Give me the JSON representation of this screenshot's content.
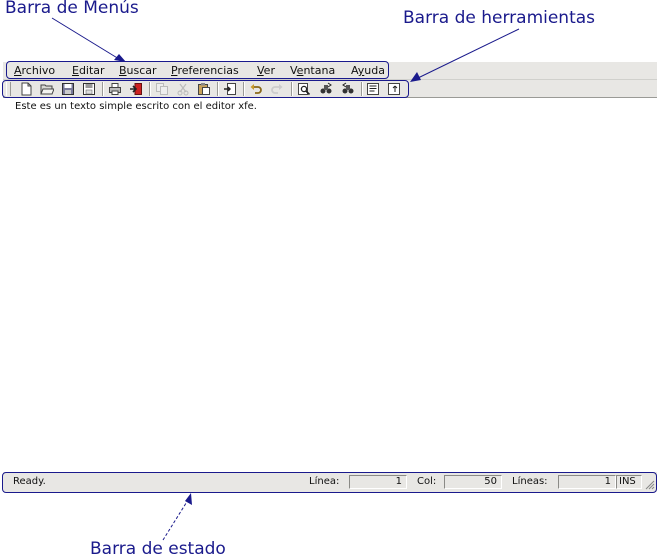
{
  "callouts": {
    "menubar": "Barra de Menús",
    "toolbar": "Barra de herramientas",
    "statusbar": "Barra de estado"
  },
  "menubar": {
    "items": [
      {
        "label": "Archivo",
        "accel": "A"
      },
      {
        "label": "Editar",
        "accel": "E"
      },
      {
        "label": "Buscar",
        "accel": "B"
      },
      {
        "label": "Preferencias",
        "accel": "P"
      },
      {
        "label": "Ver",
        "accel": "V"
      },
      {
        "label": "Ventana",
        "accel": "e"
      },
      {
        "label": "Ayuda",
        "accel": "y"
      }
    ]
  },
  "toolbar": {
    "tools": [
      {
        "name": "new-file-icon",
        "enabled": true
      },
      {
        "name": "open-folder-icon",
        "enabled": true
      },
      {
        "name": "save-icon",
        "enabled": true
      },
      {
        "name": "save-as-icon",
        "enabled": true
      },
      {
        "name": "print-icon",
        "enabled": true
      },
      {
        "name": "quit-icon",
        "enabled": true
      },
      {
        "name": "copy-icon",
        "enabled": false
      },
      {
        "name": "cut-icon",
        "enabled": false
      },
      {
        "name": "paste-icon",
        "enabled": true
      },
      {
        "name": "goto-line-icon",
        "enabled": true
      },
      {
        "name": "undo-icon",
        "enabled": true
      },
      {
        "name": "redo-icon",
        "enabled": false
      },
      {
        "name": "search-icon",
        "enabled": true
      },
      {
        "name": "find-next-icon",
        "enabled": true
      },
      {
        "name": "find-prev-icon",
        "enabled": true
      },
      {
        "name": "wrap-text-icon",
        "enabled": true
      },
      {
        "name": "settings-icon",
        "enabled": true
      }
    ]
  },
  "editor": {
    "text": "Este es un texto simple escrito con el editor xfe."
  },
  "statusbar": {
    "status": "Ready.",
    "line_label": "Línea:",
    "line_value": "1",
    "col_label": "Col:",
    "col_value": "50",
    "lines_label": "Líneas:",
    "lines_value": "1",
    "mode": "INS"
  },
  "colors": {
    "annotation": "#1a1a8c",
    "chrome": "#e8e7e4"
  }
}
